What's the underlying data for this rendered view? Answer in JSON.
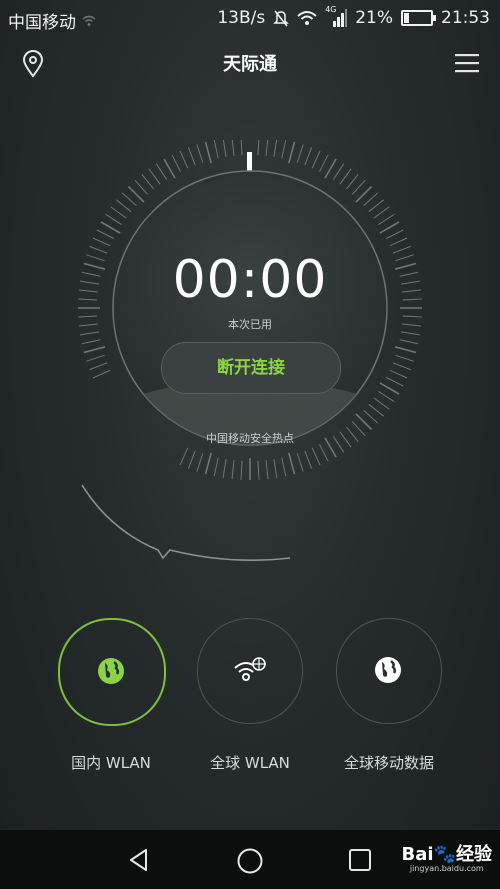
{
  "status_bar": {
    "carrier": "中国移动",
    "net_speed": "13B/s",
    "network_type": "4G",
    "battery": "21%",
    "battery_level": 0.21,
    "time": "21:53"
  },
  "header": {
    "title": "天际通",
    "location_icon": "location-pin-icon",
    "menu_icon": "hamburger-menu-icon"
  },
  "dial": {
    "timer": "00:00",
    "timer_label": "本次已用",
    "disconnect_label": "断开连接",
    "hotspot_label": "中国移动安全热点"
  },
  "actions": [
    {
      "label": "国内 WLAN",
      "icon": "globe-phone-icon",
      "active": true
    },
    {
      "label": "全球 WLAN",
      "icon": "wifi-globe-icon",
      "active": false
    },
    {
      "label": "全球移动数据",
      "icon": "globe-phone-icon",
      "active": false
    }
  ],
  "nav_bar": {
    "back_icon": "back-triangle-icon",
    "home_icon": "home-circle-icon",
    "recent_icon": "recent-square-icon",
    "watermark_main": "Bai🐾经验",
    "watermark_sub": "jingyan.baidu.com"
  },
  "colors": {
    "accent_green": "#8bd443",
    "active_ring": "#7fc03a",
    "background": "#1f2424"
  }
}
